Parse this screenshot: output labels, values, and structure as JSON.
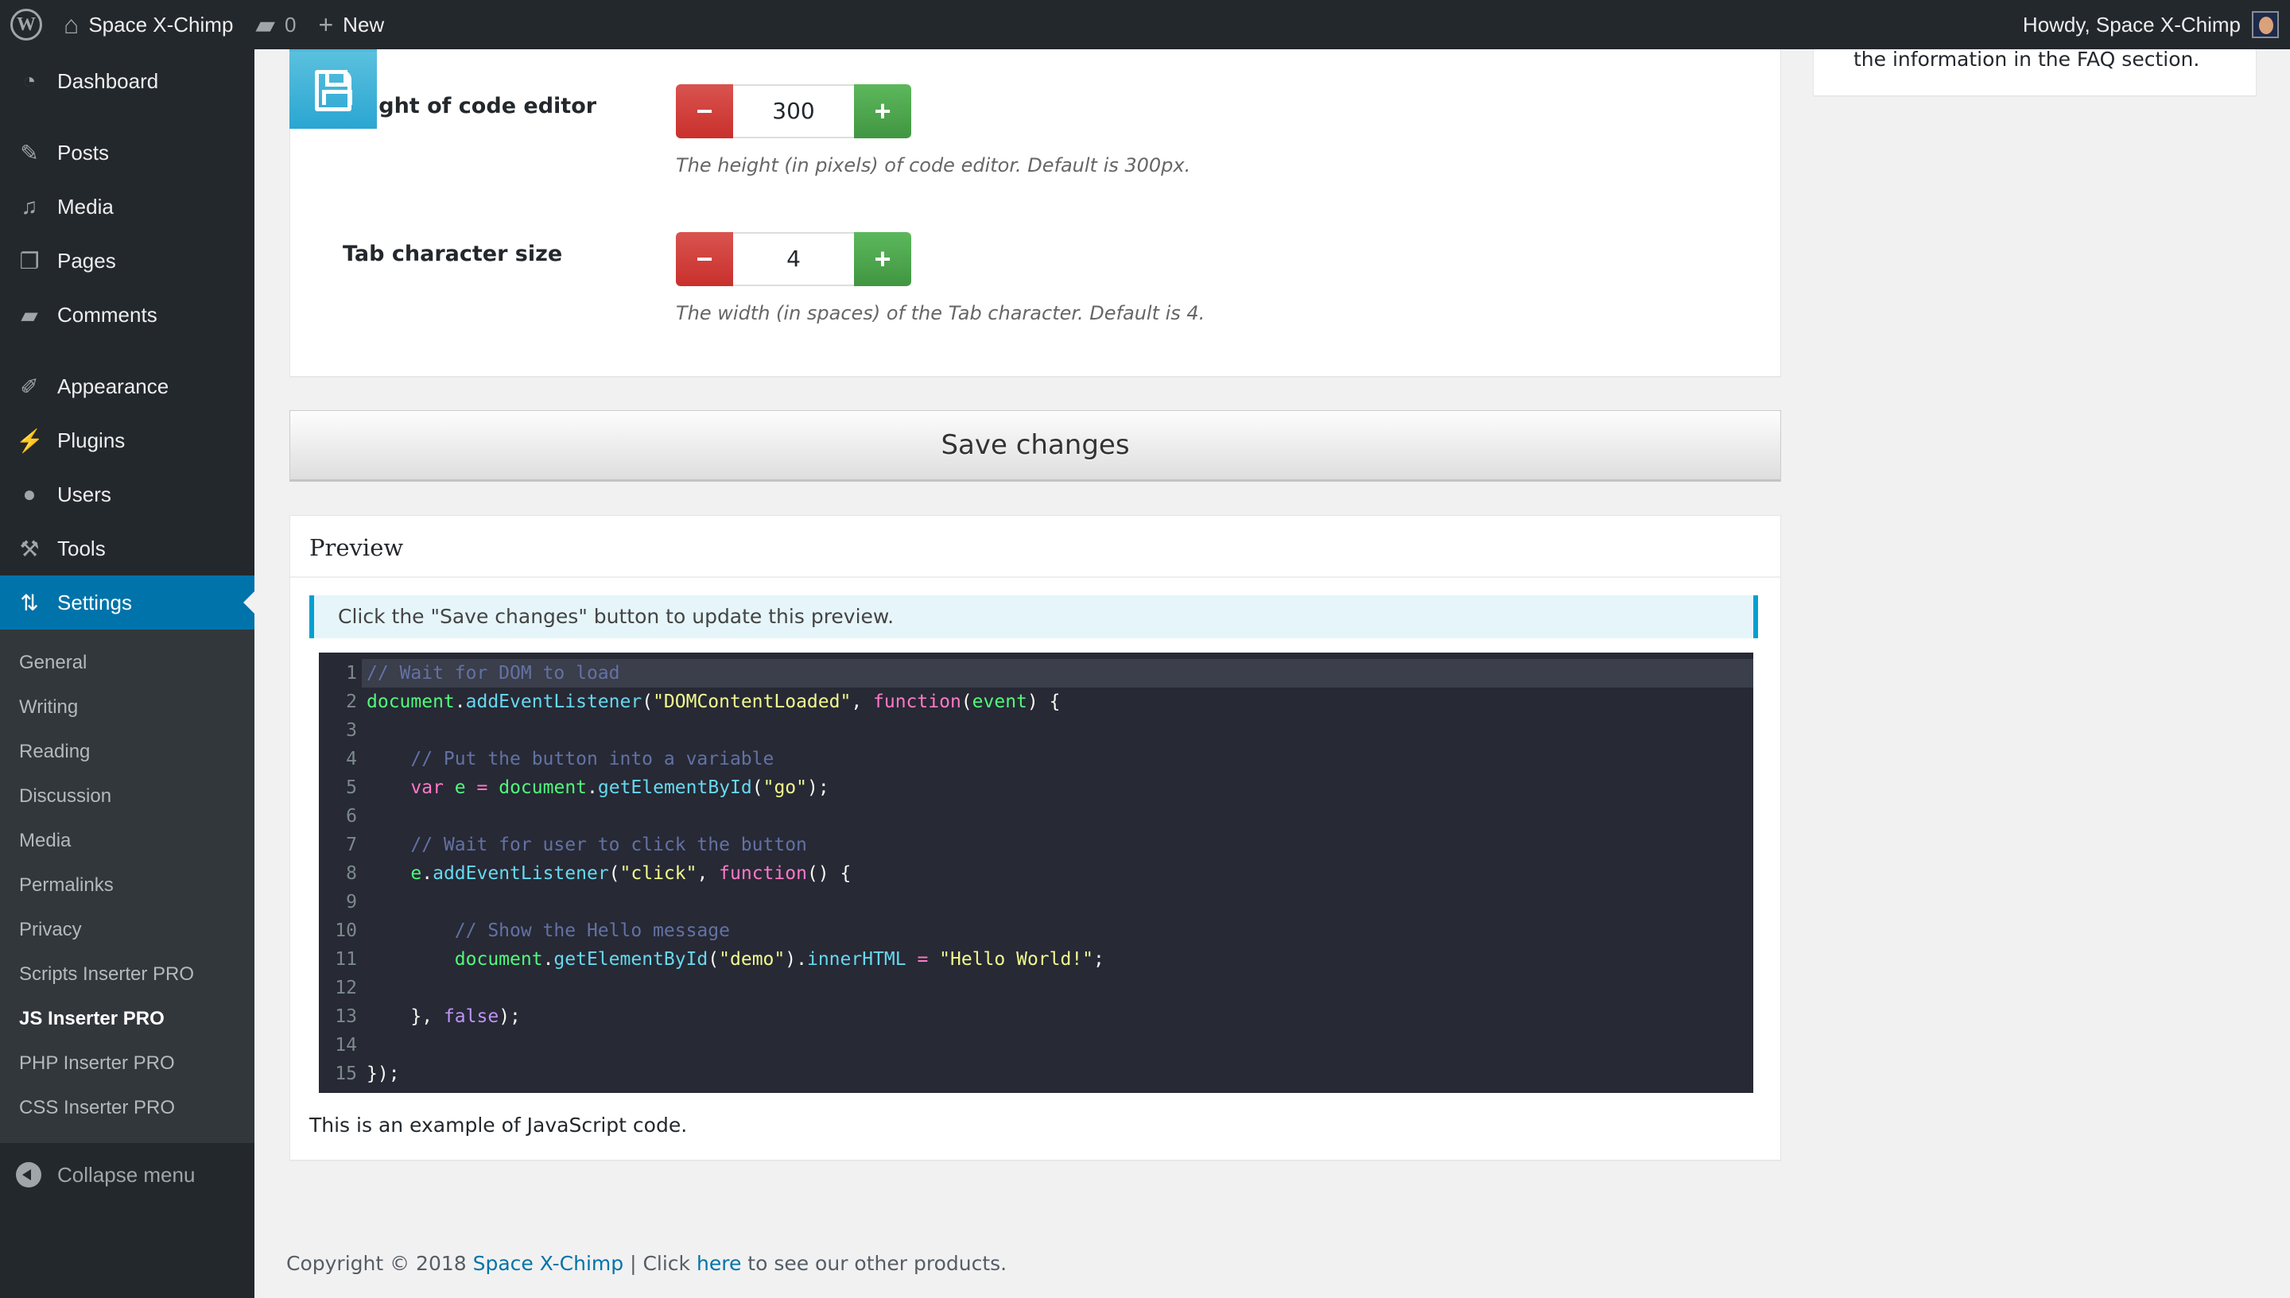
{
  "adminbar": {
    "site_name": "Space X-Chimp",
    "comments_count": "0",
    "new_label": "New",
    "howdy": "Howdy, Space X-Chimp"
  },
  "sidebar": {
    "items": [
      {
        "label": "Dashboard",
        "icon": "dashboard-icon"
      },
      {
        "label": "Posts",
        "icon": "pin-icon"
      },
      {
        "label": "Media",
        "icon": "media-icon"
      },
      {
        "label": "Pages",
        "icon": "pages-icon"
      },
      {
        "label": "Comments",
        "icon": "comment-icon"
      },
      {
        "label": "Appearance",
        "icon": "paintbrush-icon"
      },
      {
        "label": "Plugins",
        "icon": "plug-icon"
      },
      {
        "label": "Users",
        "icon": "user-icon"
      },
      {
        "label": "Tools",
        "icon": "wrench-icon"
      },
      {
        "label": "Settings",
        "icon": "settings-icon",
        "active": true
      }
    ],
    "submenu": [
      "General",
      "Writing",
      "Reading",
      "Discussion",
      "Media",
      "Permalinks",
      "Privacy",
      "Scripts Inserter PRO",
      "JS Inserter PRO",
      "PHP Inserter PRO",
      "CSS Inserter PRO"
    ],
    "submenu_current": "JS Inserter PRO",
    "collapse_label": "Collapse menu"
  },
  "settings": {
    "editor_height": {
      "label": "Height of code editor",
      "visible_label": "ight of code editor",
      "value": "300",
      "description": "The height (in pixels) of code editor. Default is 300px."
    },
    "tab_size": {
      "label": "Tab character size",
      "value": "4",
      "description": "The width (in spaces) of the Tab character. Default is 4."
    },
    "minus_symbol": "−",
    "plus_symbol": "+"
  },
  "save_button": "Save changes",
  "preview": {
    "title": "Preview",
    "notice": "Click the \"Save changes\" button to update this preview.",
    "caption": "This is an example of JavaScript code.",
    "code_lines": [
      "// Wait for DOM to load",
      "document.addEventListener(\"DOMContentLoaded\", function(event) {",
      "",
      "    // Put the button into a variable",
      "    var e = document.getElementById(\"go\");",
      "",
      "    // Wait for user to click the button",
      "    e.addEventListener(\"click\", function() {",
      "",
      "        // Show the Hello message",
      "        document.getElementById(\"demo\").innerHTML = \"Hello World!\";",
      "",
      "    }, false);",
      "",
      "});"
    ]
  },
  "side_box": {
    "text": "the information in the FAQ section."
  },
  "footer": {
    "prefix": "Copyright © 2018 ",
    "brand_link": "Space X-Chimp",
    "middle": " | Click ",
    "here_link": "here",
    "suffix": " to see our other products."
  },
  "colors": {
    "accent": "#0073aa",
    "adminbar": "#23282d",
    "minus": "#d9534f",
    "plus": "#5cb85c",
    "notice_border": "#00a0d2",
    "code_bg": "#272935"
  }
}
